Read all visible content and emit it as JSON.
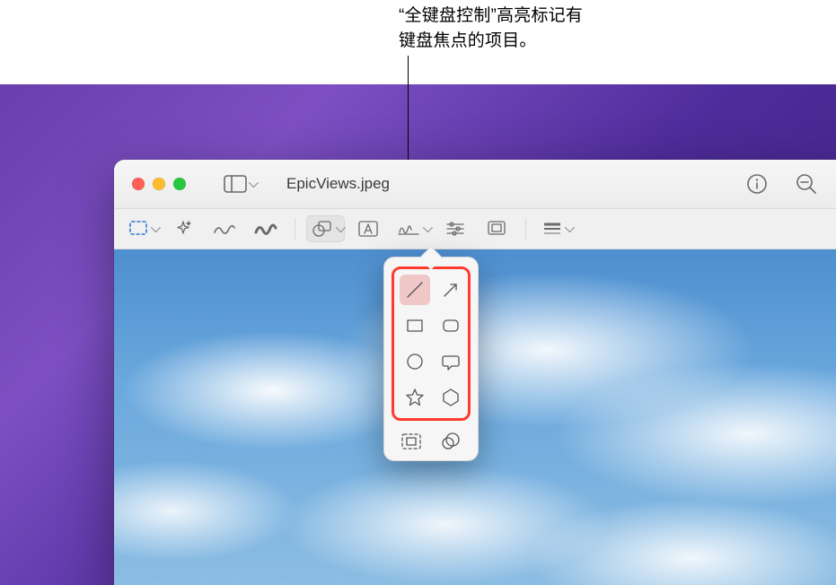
{
  "callout": {
    "line1": "“全键盘控制”高亮标记有",
    "line2": "键盘焦点的项目。"
  },
  "window": {
    "title": "EpicViews.jpeg"
  },
  "titlebar_icons": {
    "sidebar": "sidebar-icon",
    "info": "info-icon",
    "zoom_out": "zoom-out-icon"
  },
  "toolbar": {
    "items": [
      {
        "name": "selection-tool",
        "has_chevron": true
      },
      {
        "name": "instant-alpha-tool",
        "has_chevron": false
      },
      {
        "name": "sketch-tool",
        "has_chevron": false
      },
      {
        "name": "draw-tool",
        "has_chevron": false
      },
      {
        "name": "shapes-tool",
        "has_chevron": true,
        "active": true
      },
      {
        "name": "text-tool",
        "has_chevron": false
      },
      {
        "name": "sign-tool",
        "has_chevron": true
      },
      {
        "name": "adjust-color-tool",
        "has_chevron": false
      },
      {
        "name": "crop-tool",
        "has_chevron": false
      },
      {
        "name": "border-style-tool",
        "has_chevron": true
      }
    ]
  },
  "shapes_popover": {
    "items": [
      {
        "name": "line-shape",
        "focused": true
      },
      {
        "name": "arrow-shape",
        "focused": false
      },
      {
        "name": "rect-shape",
        "focused": false
      },
      {
        "name": "roundrect-shape",
        "focused": false
      },
      {
        "name": "circle-shape",
        "focused": false
      },
      {
        "name": "speech-bubble-shape",
        "focused": false
      },
      {
        "name": "star-shape",
        "focused": false
      },
      {
        "name": "hexagon-shape",
        "focused": false
      }
    ],
    "bottom": [
      {
        "name": "mask-tool"
      },
      {
        "name": "loupe-tool"
      }
    ]
  },
  "colors": {
    "focus_highlight": "#ff3b30"
  }
}
